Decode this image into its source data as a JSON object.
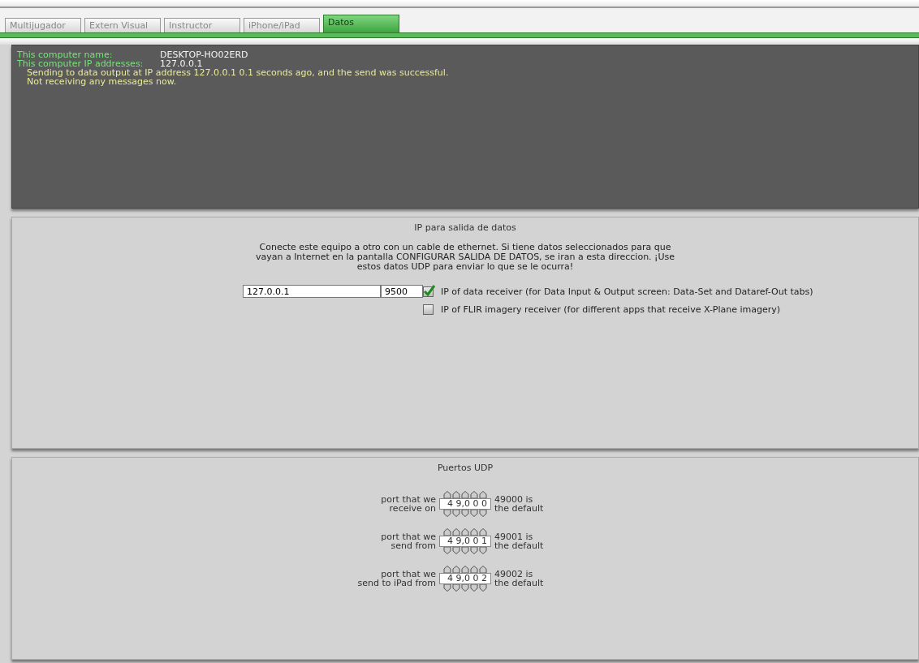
{
  "tabs": [
    {
      "label": "Multijugador",
      "selected": false
    },
    {
      "label": "Extern Visual",
      "selected": false
    },
    {
      "label": "Instructor",
      "selected": false
    },
    {
      "label": "iPhone/iPad",
      "selected": false
    },
    {
      "label": "Datos",
      "selected": true
    }
  ],
  "status": {
    "fields": [
      {
        "label": "This computer name:",
        "value": "DESKTOP-HO02ERD"
      },
      {
        "label": "This computer IP addresses:",
        "value": "127.0.0.1"
      }
    ],
    "messages": [
      "Sending to  data output at IP address 127.0.0.1  0.1 seconds ago,  and the send was successful.",
      "Not receiving any messages now."
    ]
  },
  "ip_output": {
    "title": "IP para salida de datos",
    "description": "Conecte este equipo a otro con un cable de ethernet. Si tiene datos seleccionados para que\nvayan a Internet en la pantalla CONFIGURAR SALIDA DE DATOS, se iran a esta direccion. ¡Use\nestos datos UDP para enviar lo que se le ocurra!",
    "address": "127.0.0.1",
    "port": "9500",
    "options": [
      {
        "label": "IP of data receiver (for Data Input & Output screen: Data-Set and Dataref-Out tabs)",
        "checked": true
      },
      {
        "label": "IP of FLIR imagery receiver (for different apps that receive X-Plane imagery)",
        "checked": false
      }
    ]
  },
  "udp_ports": {
    "title": "Puertos UDP",
    "ports": [
      {
        "label": "port that we\nreceive on",
        "value": "4 9,0 0 0",
        "note": "49000 is\nthe default"
      },
      {
        "label": "port that we\nsend from",
        "value": "4 9,0 0 1",
        "note": "49001 is\nthe default"
      },
      {
        "label": "port that we\nsend to iPad from",
        "value": "4 9,0 0 2",
        "note": "49002 is\nthe default"
      }
    ]
  }
}
